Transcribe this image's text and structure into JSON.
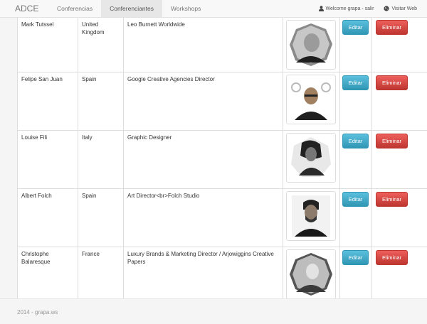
{
  "navbar": {
    "brand": "ADCE",
    "items": [
      {
        "label": "Conferencias"
      },
      {
        "label": "Conferenciantes",
        "active": true
      },
      {
        "label": "Workshops"
      }
    ],
    "welcome": "Welcome grapa - salir",
    "visit": "Visitar Web"
  },
  "table": {
    "rows": [
      {
        "name": "Mark Tutssel",
        "country": "United Kingdom",
        "description": "Leo Burnett Worldwide",
        "edit_label": "Editar",
        "delete_label": "Eliminar"
      },
      {
        "name": "Felipe San Juan",
        "country": "Spain",
        "description": "Google Creative Agencies Director",
        "edit_label": "Editar",
        "delete_label": "Eliminar"
      },
      {
        "name": "Louise Fili",
        "country": "Italy",
        "description": "Graphic Designer",
        "edit_label": "Editar",
        "delete_label": "Eliminar"
      },
      {
        "name": "Albert Folch",
        "country": "Spain",
        "description": "Art Director<br>Folch Studio",
        "edit_label": "Editar",
        "delete_label": "Eliminar"
      },
      {
        "name": "Christophe Balaresque",
        "country": "France",
        "description": "Luxury Brands & Marketing Director / Arjowiggins Creative Papers",
        "edit_label": "Editar",
        "delete_label": "Eliminar"
      }
    ]
  },
  "footer": {
    "text": "2014 - grapa.ws"
  },
  "colors": {
    "edit": "#5bc0de",
    "delete": "#d9534f",
    "navbar": "#f8f8f8"
  }
}
